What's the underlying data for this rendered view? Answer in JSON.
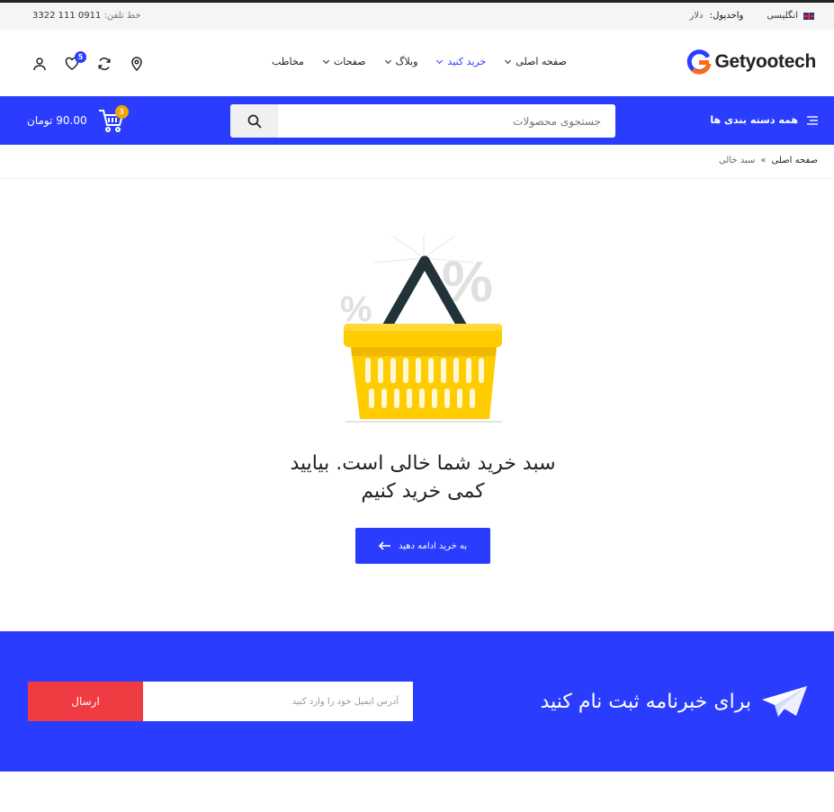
{
  "topbar": {
    "phone_label": "خط تلفن:",
    "phone_number": "0911 111 3322",
    "language": "انگلیسی",
    "currency_label": "واحدپول:",
    "currency_value": "دلار"
  },
  "header": {
    "logo_text": "Getyootech",
    "nav": [
      {
        "label": "صفحه اصلی"
      },
      {
        "label": "خرید کنید"
      },
      {
        "label": "وبلاگ"
      },
      {
        "label": "صفحات"
      },
      {
        "label": "مخاطب"
      }
    ],
    "wishlist_count": "5"
  },
  "bluebar": {
    "all_categories": "همه دسته بندی ها",
    "search_placeholder": "جستجوی محصولات",
    "cart_total": "90.00 تومان",
    "cart_count": "3"
  },
  "breadcrumb": {
    "home": "صفحه اصلی",
    "separator": "»",
    "current": "سبد خالی"
  },
  "empty_cart": {
    "message_line1": "سبد خرید شما خالی است. بیایید",
    "message_line2": "کمی خرید کنیم",
    "continue_button": "به خرید ادامه دهید"
  },
  "newsletter": {
    "title": "برای خبرنامه ثبت نام کنید",
    "email_placeholder": "آدرس ایمیل خود را وارد کنید",
    "send_button": "ارسال"
  },
  "colors": {
    "primary": "#2a3dff",
    "send_button": "#ef3c43",
    "cart_badge": "#f7a600",
    "basket_yellow": "#ffcc00"
  }
}
